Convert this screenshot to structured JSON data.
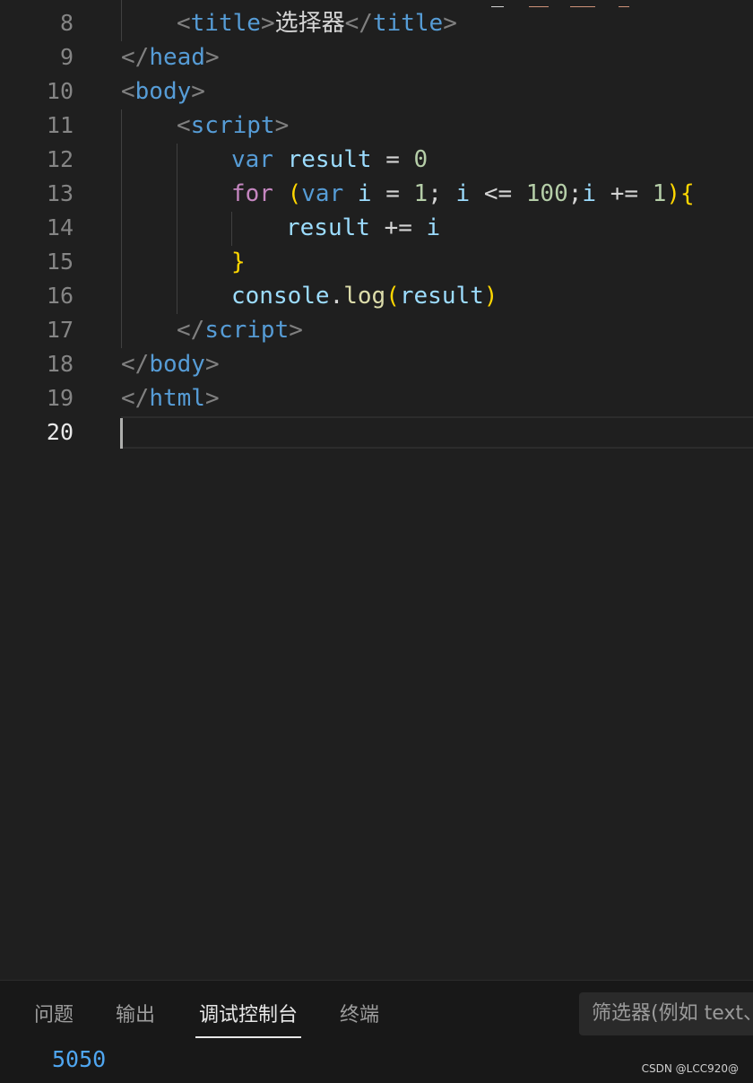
{
  "editor": {
    "line_numbers": [
      "8",
      "9",
      "10",
      "11",
      "12",
      "13",
      "14",
      "15",
      "16",
      "17",
      "18",
      "19",
      "20"
    ],
    "active_line": "20",
    "lines": {
      "l8": {
        "lt1": "<",
        "tag1": "title",
        "gt1": ">",
        "text": "选择器",
        "lt2": "</",
        "tag2": "title",
        "gt2": ">"
      },
      "l9": {
        "lt": "</",
        "tag": "head",
        "gt": ">"
      },
      "l10": {
        "lt": "<",
        "tag": "body",
        "gt": ">"
      },
      "l11": {
        "lt": "<",
        "tag": "script",
        "gt": ">"
      },
      "l12": {
        "kw": "var",
        "name": "result",
        "op": "=",
        "num": "0"
      },
      "l13": {
        "ctl": "for",
        "paren_open": "(",
        "kw": "var",
        "v1": "i",
        "op1": "=",
        "n1": "1",
        "semi1": ";",
        "v2": "i",
        "op2": "<=",
        "n2": "100",
        "semi2": ";",
        "v3": "i",
        "op3": "+=",
        "n3": "1",
        "paren_close": ")",
        "brace": "{"
      },
      "l14": {
        "name": "result",
        "op": "+=",
        "v": "i"
      },
      "l15": {
        "brace": "}"
      },
      "l16": {
        "obj": "console",
        "dot": ".",
        "fn": "log",
        "paren_open": "(",
        "arg": "result",
        "paren_close": ")"
      },
      "l17": {
        "lt": "</",
        "tag": "script",
        "gt": ">"
      },
      "l18": {
        "lt": "</",
        "tag": "body",
        "gt": ">"
      },
      "l19": {
        "lt": "</",
        "tag": "html",
        "gt": ">"
      }
    }
  },
  "panel": {
    "tabs": [
      "问题",
      "输出",
      "调试控制台",
      "终端"
    ],
    "active_tab": "调试控制台",
    "filter_placeholder": "筛选器(例如 text、",
    "output": "5050"
  },
  "watermark": "CSDN @LCC920@",
  "colors": {
    "background": "#1f1f1f",
    "tag": "#569cd6",
    "keyword_control": "#c586c0",
    "variable": "#9cdcfe",
    "number": "#b5cea8",
    "function": "#dcdcaa",
    "bracket": "#ffd700",
    "console_output": "#4fa6f0"
  }
}
